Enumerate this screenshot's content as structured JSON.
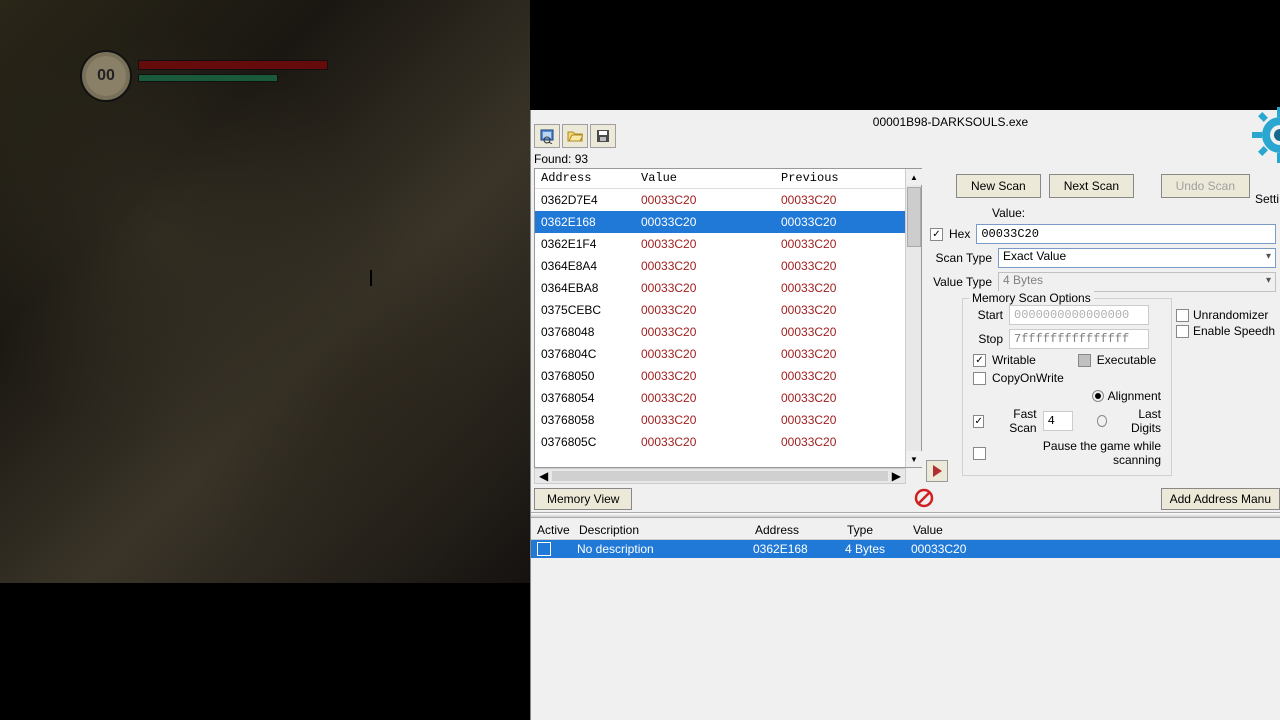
{
  "hud": {
    "ring_text": "00"
  },
  "window": {
    "title": "00001B98-DARKSOULS.exe",
    "settings_cut": "Setti"
  },
  "toolbar": {
    "found_label": "Found: 93"
  },
  "buttons": {
    "new_scan": "New Scan",
    "next_scan": "Next Scan",
    "undo_scan": "Undo Scan",
    "memory_view": "Memory View",
    "add_manual": "Add Address Manu"
  },
  "labels": {
    "value": "Value:",
    "hex": "Hex",
    "scan_type": "Scan Type",
    "value_type": "Value Type",
    "mem_scan_options": "Memory Scan Options",
    "start": "Start",
    "stop": "Stop",
    "writable": "Writable",
    "executable": "Executable",
    "copyonwrite": "CopyOnWrite",
    "alignment": "Alignment",
    "last_digits": "Last Digits",
    "fast_scan": "Fast Scan",
    "pause_game": "Pause the game while scanning",
    "unrandomizer": "Unrandomizer",
    "enable_speedh": "Enable Speedh"
  },
  "inputs": {
    "value": "00033C20",
    "scan_type": "Exact Value",
    "value_type": "4 Bytes",
    "start": "0000000000000000",
    "stop": "7fffffffffffffff",
    "fast_scan": "4"
  },
  "results": {
    "headers": {
      "address": "Address",
      "value": "Value",
      "previous": "Previous"
    },
    "rows": [
      {
        "address": "0362D7E4",
        "value": "00033C20",
        "previous": "00033C20"
      },
      {
        "address": "0362E168",
        "value": "00033C20",
        "previous": "00033C20",
        "selected": true
      },
      {
        "address": "0362E1F4",
        "value": "00033C20",
        "previous": "00033C20"
      },
      {
        "address": "0364E8A4",
        "value": "00033C20",
        "previous": "00033C20"
      },
      {
        "address": "0364EBA8",
        "value": "00033C20",
        "previous": "00033C20"
      },
      {
        "address": "0375CEBC",
        "value": "00033C20",
        "previous": "00033C20"
      },
      {
        "address": "03768048",
        "value": "00033C20",
        "previous": "00033C20"
      },
      {
        "address": "0376804C",
        "value": "00033C20",
        "previous": "00033C20"
      },
      {
        "address": "03768050",
        "value": "00033C20",
        "previous": "00033C20"
      },
      {
        "address": "03768054",
        "value": "00033C20",
        "previous": "00033C20"
      },
      {
        "address": "03768058",
        "value": "00033C20",
        "previous": "00033C20"
      },
      {
        "address": "0376805C",
        "value": "00033C20",
        "previous": "00033C20"
      }
    ]
  },
  "addrlist": {
    "headers": {
      "active": "Active",
      "description": "Description",
      "address": "Address",
      "type": "Type",
      "value": "Value"
    },
    "row": {
      "description": "No description",
      "address": "0362E168",
      "type": "4 Bytes",
      "value": "00033C20"
    }
  }
}
